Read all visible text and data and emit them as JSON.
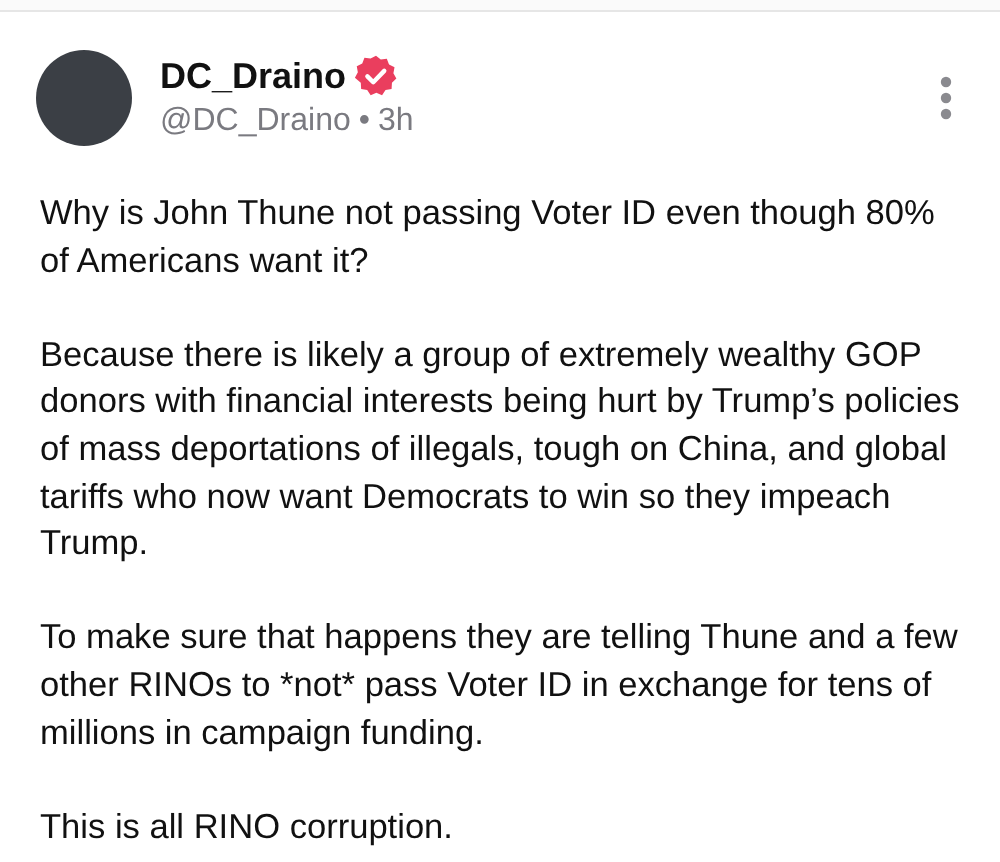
{
  "author": {
    "name": "DC_Draino",
    "verified": true,
    "handle": "@DC_Draino",
    "separator": "•",
    "time": "3h"
  },
  "paragraphs": [
    "Why is John Thune not passing Voter ID even though 80% of Americans want it?",
    "Because there is likely a group of extremely wealthy GOP donors with financial interests being hurt by Trump’s policies of mass deportations of illegals, tough on China, and global tariffs who now want Democrats to win so they impeach Trump.",
    "To make sure that happens they are telling Thune and a few other RINOs to *not* pass Voter ID in exchange for tens of millions in campaign funding.",
    "This is all RINO corruption."
  ]
}
